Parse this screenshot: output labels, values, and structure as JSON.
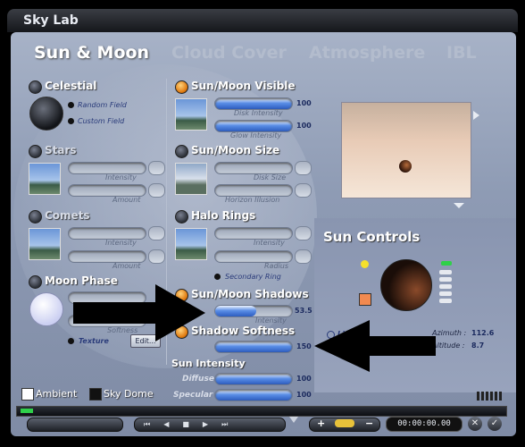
{
  "window": {
    "title": "Sky Lab"
  },
  "tabs": [
    {
      "label": "Sun & Moon",
      "active": true
    },
    {
      "label": "Cloud Cover",
      "active": false
    },
    {
      "label": "Atmosphere",
      "active": false
    },
    {
      "label": "IBL",
      "active": false
    }
  ],
  "celestial": {
    "label": "Celestial",
    "random_field": "Random Field",
    "custom_field": "Custom Field"
  },
  "stars": {
    "label": "Stars",
    "intensity": "Intensity",
    "amount": "Amount"
  },
  "comets": {
    "label": "Comets",
    "intensity": "Intensity",
    "amount": "Amount"
  },
  "moon_phase": {
    "label": "Moon Phase",
    "softness": "Softness",
    "texture": "Texture",
    "edit_button": "Edit..."
  },
  "sun_moon_visible": {
    "label": "Sun/Moon Visible",
    "disk_intensity": "Disk Intensity",
    "disk_value": "100",
    "glow_intensity": "Glow Intensity",
    "glow_value": "100"
  },
  "sun_moon_size": {
    "label": "Sun/Moon Size",
    "disk_size": "Disk Size",
    "horizon_illusion": "Horizon Illusion"
  },
  "halo_rings": {
    "label": "Halo Rings",
    "intensity": "Intensity",
    "radius": "Radius",
    "secondary_ring": "Secondary Ring"
  },
  "sun_moon_shadows": {
    "label": "Sun/Moon Shadows",
    "intensity": "Intensity",
    "value": "53.5",
    "fill_fraction": 0.535
  },
  "shadow_softness": {
    "label": "Shadow Softness",
    "value": "150"
  },
  "sun_intensity": {
    "label": "Sun Intensity",
    "diffuse": "Diffuse",
    "diffuse_value": "100",
    "specular": "Specular",
    "specular_value": "100"
  },
  "sun_controls": {
    "label": "Sun Controls",
    "light": "Li",
    "azimuth_label": "Azimuth :",
    "azimuth_value": "112.6",
    "altitude_label": "Altitude :",
    "altitude_value": "8.7"
  },
  "footer": {
    "ambient": "Ambient",
    "sky_dome": "Sky Dome",
    "time": "00:00:00.00"
  },
  "colors": {
    "accent_orange": "#e07a10",
    "slider_blue": "#2c5cc0",
    "panel": "#8e9bb4"
  }
}
